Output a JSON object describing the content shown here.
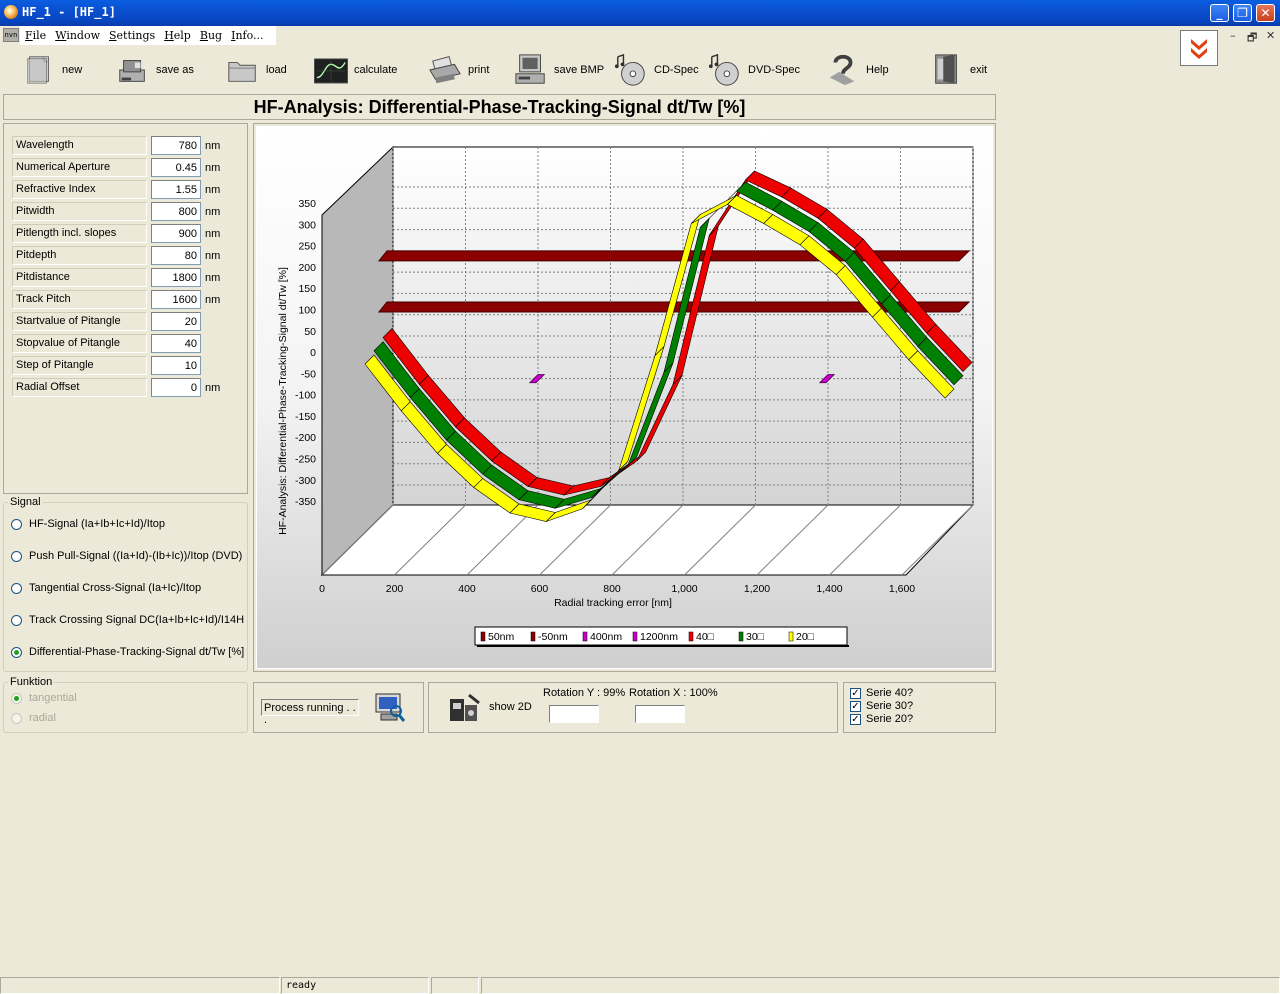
{
  "window": {
    "title": "HF_1 - [HF_1]",
    "minimize": "_",
    "restore": "❐",
    "close": "✕",
    "mdi_min": "–",
    "mdi_restore": "🗗",
    "mdi_close": "✕",
    "mdi_icon": "nvn"
  },
  "menu": [
    "File",
    "Window",
    "Settings",
    "Help",
    "Bug",
    "Info..."
  ],
  "toolbar": [
    {
      "label": "new",
      "icon": "new-document-icon"
    },
    {
      "label": "save as",
      "icon": "save-as-icon"
    },
    {
      "label": "load",
      "icon": "folder-icon"
    },
    {
      "label": "calculate",
      "icon": "oscilloscope-icon"
    },
    {
      "label": "print",
      "icon": "printer-icon"
    },
    {
      "label": "save BMP",
      "icon": "computer-icon"
    },
    {
      "label": "CD-Spec",
      "icon": "cd-icon"
    },
    {
      "label": "DVD-Spec",
      "icon": "dvd-icon"
    },
    {
      "label": "Help",
      "icon": "help-icon"
    },
    {
      "label": "exit",
      "icon": "exit-door-icon"
    }
  ],
  "heading": "HF-Analysis: Differential-Phase-Tracking-Signal dt/Tw [%]",
  "parameters": [
    {
      "label": "Wavelength",
      "value": "780",
      "unit": "nm"
    },
    {
      "label": "Numerical Aperture",
      "value": "0.45",
      "unit": "nm"
    },
    {
      "label": "Refractive Index",
      "value": "1.55",
      "unit": "nm"
    },
    {
      "label": "Pitwidth",
      "value": "800",
      "unit": "nm"
    },
    {
      "label": "Pitlength incl. slopes",
      "value": "900",
      "unit": "nm"
    },
    {
      "label": "Pitdepth",
      "value": "80",
      "unit": "nm"
    },
    {
      "label": "Pitdistance",
      "value": "1800",
      "unit": "nm"
    },
    {
      "label": "Track Pitch",
      "value": "1600",
      "unit": "nm"
    },
    {
      "label": "Startvalue of Pitangle",
      "value": "20",
      "unit": ""
    },
    {
      "label": "Stopvalue of Pitangle",
      "value": "40",
      "unit": ""
    },
    {
      "label": "Step of Pitangle",
      "value": "10",
      "unit": ""
    },
    {
      "label": "Radial Offset",
      "value": "0",
      "unit": "nm"
    }
  ],
  "signal": {
    "legend": "Signal",
    "options": [
      {
        "label": "HF-Signal (Ia+Ib+Ic+Id)/Itop",
        "selected": false
      },
      {
        "label": "Push Pull-Signal ((Ia+Id)-(Ib+Ic))/Itop (DVD)",
        "selected": false
      },
      {
        "label": "Tangential Cross-Signal (Ia+Ic)/Itop",
        "selected": false
      },
      {
        "label": "Track Crossing Signal DC(Ia+Ib+Ic+Id)/I14H",
        "selected": false
      },
      {
        "label": "Differential-Phase-Tracking-Signal dt/Tw [%]",
        "selected": true
      }
    ]
  },
  "funktion": {
    "legend": "Funktion",
    "options": [
      {
        "label": "tangential",
        "selected": true
      },
      {
        "label": "radial",
        "selected": false
      }
    ]
  },
  "process": {
    "status": "Process running . . ."
  },
  "rotation": {
    "show2d": "show 2D",
    "rot_y_label": "Rotation Y : 99%",
    "rot_x_label": "Rotation X : 100%",
    "rot_y": 0.99,
    "rot_x": 1.0
  },
  "series_checks": [
    {
      "label": "Serie 40?",
      "checked": true
    },
    {
      "label": "Serie 30?",
      "checked": true
    },
    {
      "label": "Serie 20?",
      "checked": true
    }
  ],
  "status": {
    "text": "ready"
  },
  "chart_data": {
    "type": "line",
    "title": "",
    "xlabel": "Radial tracking error [nm]",
    "ylabel": "HF-Analysis: Differential-Phase-Tracking-Signal dt/Tw [%]",
    "xlim": [
      0,
      1600
    ],
    "ylim": [
      -350,
      350
    ],
    "x_ticks": [
      "0",
      "200",
      "400",
      "600",
      "800",
      "1,000",
      "1,200",
      "1,400",
      "1,600"
    ],
    "y_ticks": [
      "350",
      "300",
      "250",
      "200",
      "150",
      "100",
      "50",
      "0",
      "-50",
      "-100",
      "-150",
      "-200",
      "-250",
      "-300",
      "-350"
    ],
    "x": [
      0,
      100,
      200,
      300,
      400,
      500,
      600,
      700,
      800,
      900,
      1000,
      1100,
      1200,
      1300,
      1400,
      1500,
      1600
    ],
    "series": [
      {
        "name": "40",
        "color": "#ee0000",
        "values": [
          20,
          -90,
          -190,
          -270,
          -330,
          -350,
          -330,
          -270,
          -90,
          260,
          390,
          350,
          300,
          230,
          130,
          30,
          -60
        ]
      },
      {
        "name": "30",
        "color": "#008000",
        "values": [
          10,
          -100,
          -200,
          -280,
          -340,
          -360,
          -335,
          -260,
          -40,
          300,
          385,
          340,
          290,
          220,
          120,
          20,
          -70
        ]
      },
      {
        "name": "20",
        "color": "#ffff00",
        "values": [
          0,
          -110,
          -210,
          -290,
          -350,
          -370,
          -340,
          -250,
          20,
          330,
          375,
          330,
          280,
          210,
          110,
          10,
          -80
        ]
      }
    ],
    "reference_lines": [
      {
        "name": "50nm",
        "color": "#8b0000",
        "value": 200
      },
      {
        "name": "-50nm",
        "color": "#8b0000",
        "value": 80
      }
    ],
    "markers": [
      {
        "name": "400nm",
        "color": "#cc00cc",
        "x": 400,
        "y": -100
      },
      {
        "name": "1200nm",
        "color": "#cc00cc",
        "x": 1200,
        "y": -100
      }
    ],
    "legend": [
      "50nm",
      "-50nm",
      "400nm",
      "1200nm",
      "40□",
      "30□",
      "20□"
    ],
    "legend_colors": [
      "#8b0000",
      "#8b0000",
      "#cc00cc",
      "#cc00cc",
      "#ee0000",
      "#008000",
      "#ffff00"
    ],
    "legend_position": "bottom",
    "grid": true
  }
}
